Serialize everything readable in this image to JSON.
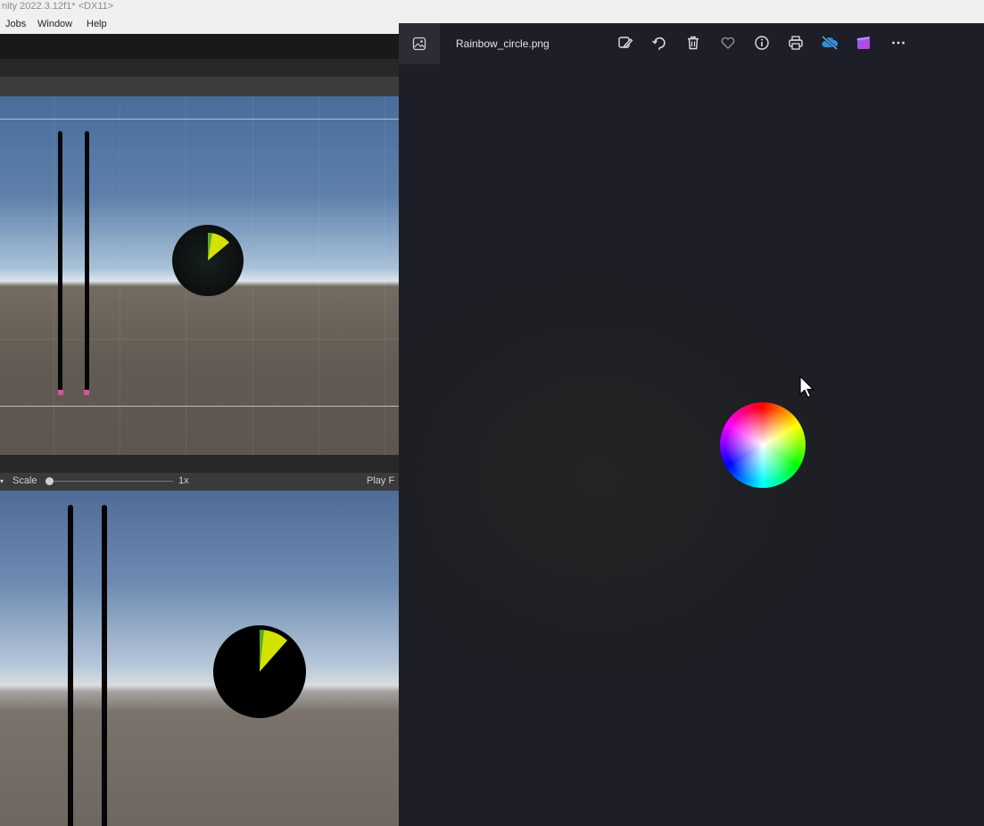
{
  "unity": {
    "window_title": "nity 2022.3.12f1* <DX11>",
    "menu": [
      "Jobs",
      "Window",
      "Help"
    ],
    "game_toolbar": {
      "scale_label": "Scale",
      "scale_value": "1x",
      "play_focus_label": "Play F"
    }
  },
  "photos": {
    "file_name": "Rainbow_circle.png",
    "toolbar_icons": [
      "edit-image-icon",
      "rotate-icon",
      "delete-icon",
      "favorite-icon",
      "info-icon",
      "print-icon",
      "onedrive-sync-icon",
      "clipchamp-icon",
      "more-options-icon"
    ]
  },
  "colors": {
    "photos_bg": "#1d1e27",
    "pie_fill": "#d4e200",
    "bar_marker": "#e0509a",
    "onedrive_blue": "#2d8fe0"
  }
}
